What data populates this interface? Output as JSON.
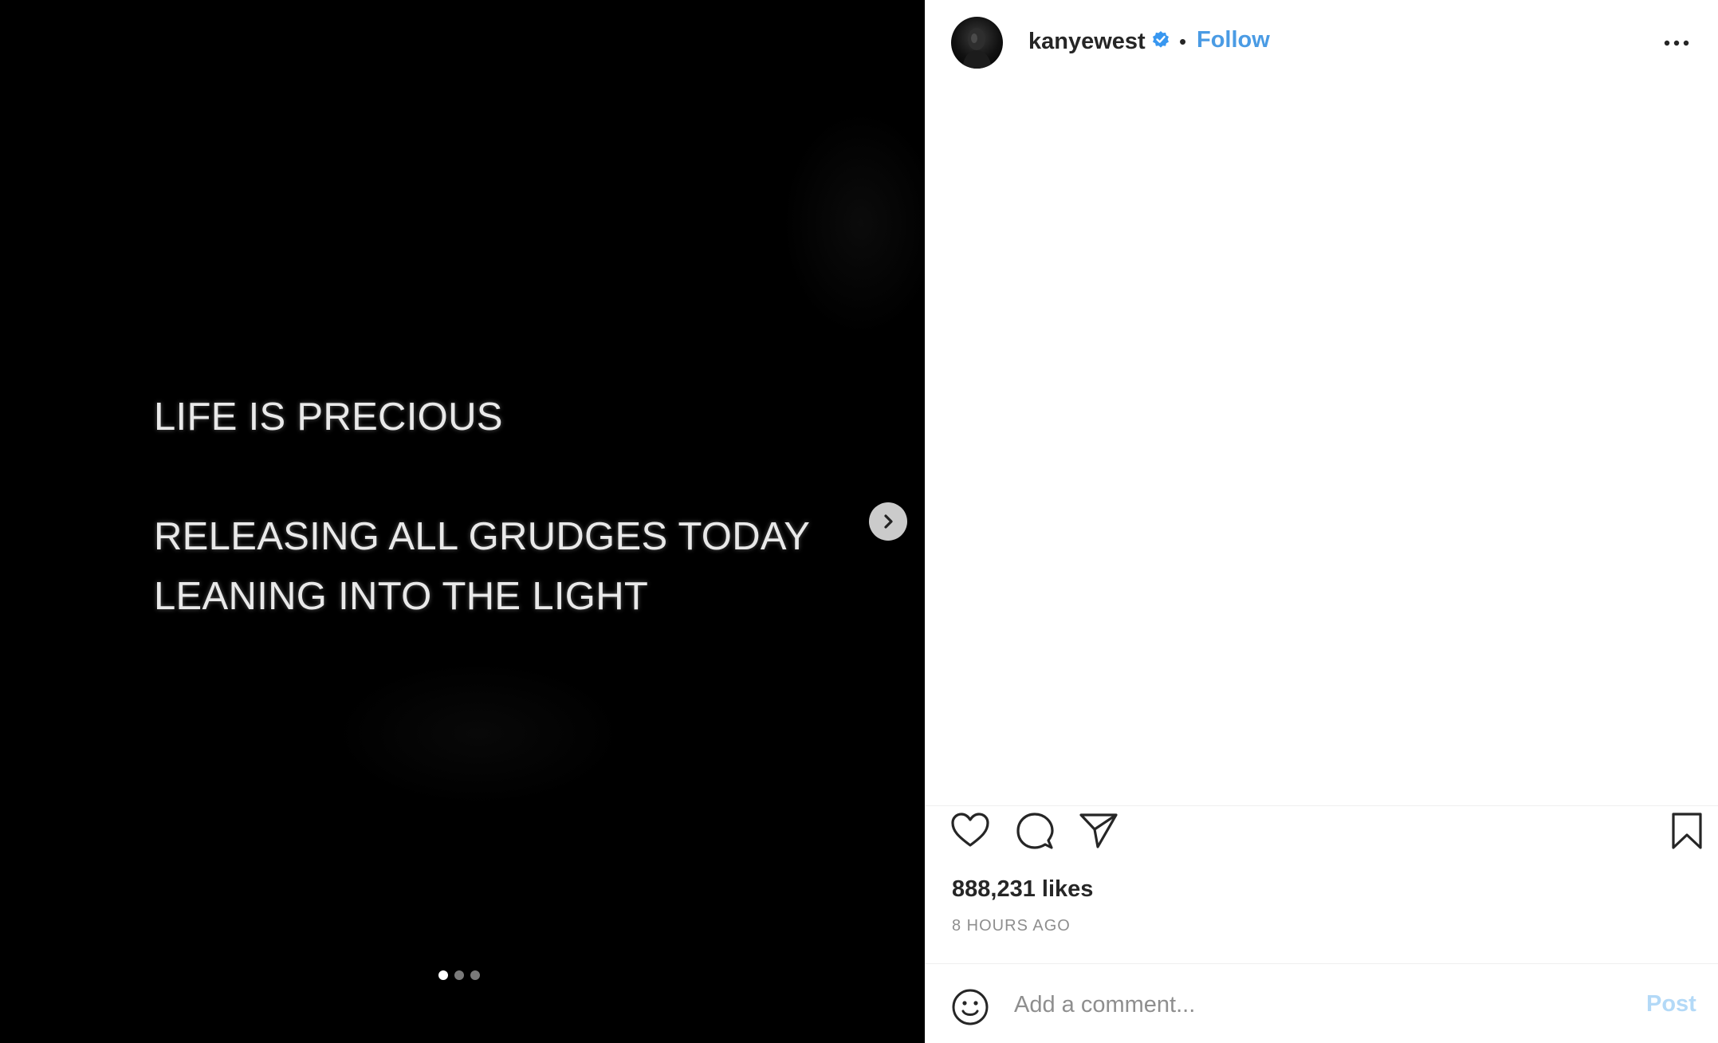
{
  "media": {
    "lines": [
      "LIFE IS PRECIOUS",
      "RELEASING ALL GRUDGES TODAY",
      "LEANING INTO THE LIGHT"
    ],
    "next_icon": "chevron-right-icon",
    "carousel": {
      "total": 3,
      "active": 1
    }
  },
  "header": {
    "avatar_icon": "profile-avatar",
    "username": "kanyewest",
    "verified_icon": "verified-badge-icon",
    "separator": "•",
    "follow_label": "Follow",
    "more_icon": "more-options-icon"
  },
  "actions": {
    "like_icon": "heart-icon",
    "comment_icon": "comment-icon",
    "share_icon": "paper-plane-icon",
    "save_icon": "bookmark-icon"
  },
  "post": {
    "likes": "888,231 likes",
    "time": "8 HOURS AGO"
  },
  "comment": {
    "emoji_icon": "emoji-icon",
    "placeholder": "Add a comment...",
    "post_label": "Post"
  },
  "colors": {
    "media_bg": "#000000",
    "link_blue": "#4a9be4",
    "post_disabled": "#b3d9f7",
    "text_primary": "#262626",
    "text_secondary": "#8e8e8e"
  }
}
